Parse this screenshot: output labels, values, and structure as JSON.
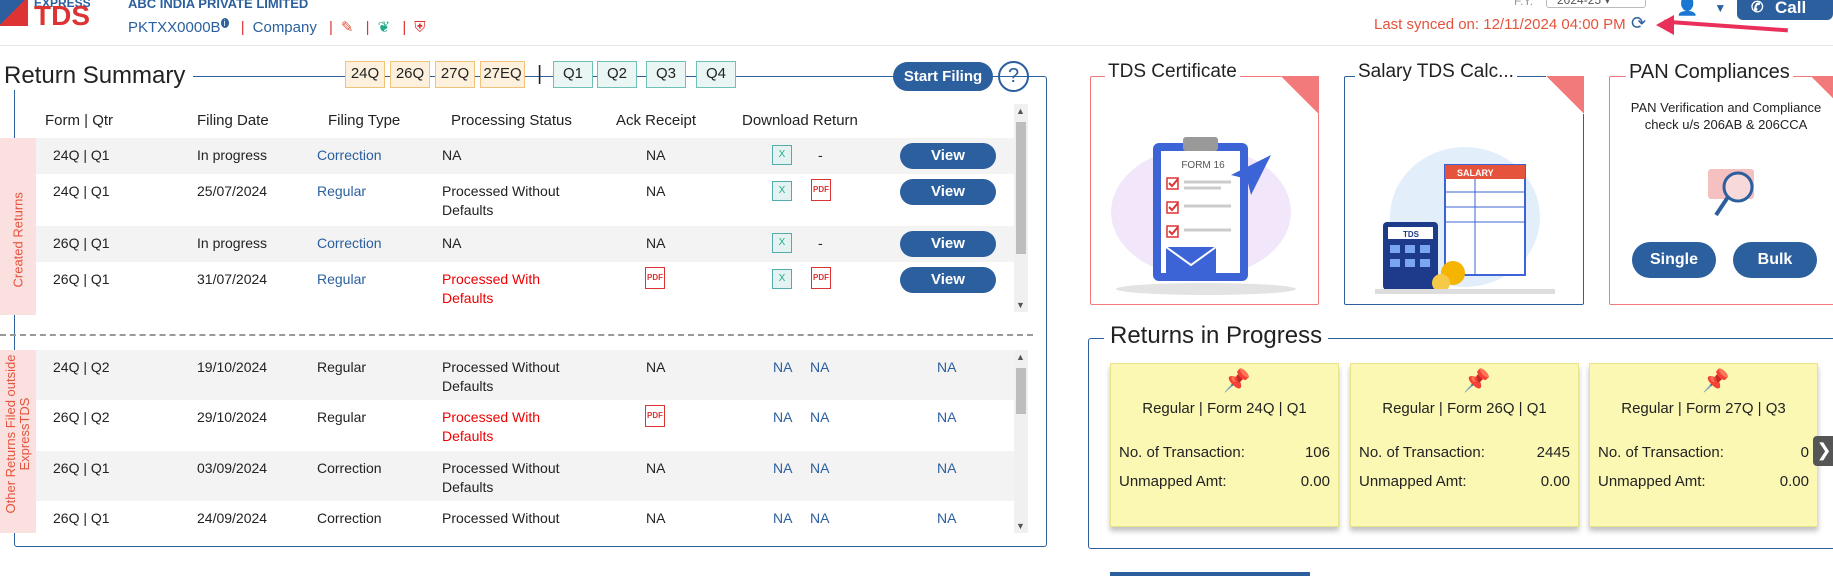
{
  "header": {
    "logo_top": "EXPRESS",
    "logo_main": "TDS",
    "company_name": "ABC INDIA PRIVATE LIMITED",
    "pan": "PKTXX0000B",
    "info_badge": "i",
    "entity_type": "Company",
    "fy_label": "F.Y.",
    "fy_value": "2024-25",
    "last_synced": "Last synced on: 12/11/2024 04:00 PM",
    "call_me": "Call Me"
  },
  "return_summary": {
    "title": "Return Summary",
    "form_filters": [
      "24Q",
      "26Q",
      "27Q",
      "27EQ"
    ],
    "quarter_filters": [
      "Q1",
      "Q2",
      "Q3",
      "Q4"
    ],
    "start_filing": "Start Filing",
    "help": "?",
    "columns": [
      "Form | Qtr",
      "Filing Date",
      "Filing Type",
      "Processing Status",
      "Ack Receipt",
      "Download Return"
    ],
    "created_label": "Created Returns",
    "other_label": "Other Returns Filed outside ExpressTDS",
    "created_rows": [
      {
        "form": "24Q | Q1",
        "date": "In progress",
        "type": "Correction",
        "status": "NA",
        "ack": "NA",
        "dash": "-",
        "view": "View"
      },
      {
        "form": "24Q | Q1",
        "date": "25/07/2024",
        "type": "Regular",
        "status": "Processed Without Defaults",
        "ack": "NA",
        "view": "View"
      },
      {
        "form": "26Q | Q1",
        "date": "In progress",
        "type": "Correction",
        "status": "NA",
        "ack": "NA",
        "dash": "-",
        "view": "View"
      },
      {
        "form": "26Q | Q1",
        "date": "31/07/2024",
        "type": "Regular",
        "status": "Processed With Defaults",
        "view": "View"
      }
    ],
    "other_rows": [
      {
        "form": "24Q | Q2",
        "date": "19/10/2024",
        "type": "Regular",
        "status": "Processed Without Defaults",
        "ack": "NA",
        "d1": "NA",
        "d2": "NA",
        "d3": "NA"
      },
      {
        "form": "26Q | Q2",
        "date": "29/10/2024",
        "type": "Regular",
        "status": "Processed With Defaults",
        "d1": "NA",
        "d2": "NA",
        "d3": "NA"
      },
      {
        "form": "26Q | Q1",
        "date": "03/09/2024",
        "type": "Correction",
        "status": "Processed Without Defaults",
        "ack": "NA",
        "d1": "NA",
        "d2": "NA",
        "d3": "NA"
      },
      {
        "form": "26Q | Q1",
        "date": "24/09/2024",
        "type": "Correction",
        "status": "Processed Without",
        "ack": "NA",
        "d1": "NA",
        "d2": "NA",
        "d3": "NA"
      }
    ]
  },
  "cards": {
    "tds_certificate": {
      "title": "TDS Certificate",
      "form_label": "FORM 16"
    },
    "salary_calc": {
      "title": "Salary TDS Calc...",
      "sheet_label": "SALARY",
      "device_label": "TDS"
    },
    "pan_compliance": {
      "title": "PAN Compliances",
      "desc": "PAN Verification and Compliance check u/s 206AB & 206CCA",
      "single": "Single",
      "bulk": "Bulk"
    }
  },
  "returns_in_progress": {
    "title": "Returns in Progress",
    "transactions_label": "No. of Transaction:",
    "unmapped_label": "Unmapped Amt:",
    "items": [
      {
        "title": "Regular | Form 24Q | Q1",
        "transactions": "106",
        "unmapped": "0.00"
      },
      {
        "title": "Regular | Form 26Q | Q1",
        "transactions": "2445",
        "unmapped": "0.00"
      },
      {
        "title": "Regular | Form 27Q | Q3",
        "transactions": "0",
        "unmapped": "0.00"
      }
    ]
  },
  "colors": {
    "primary": "#2b5f9e",
    "accent_red": "#e5533d",
    "note_yellow": "#fbf8b4"
  }
}
